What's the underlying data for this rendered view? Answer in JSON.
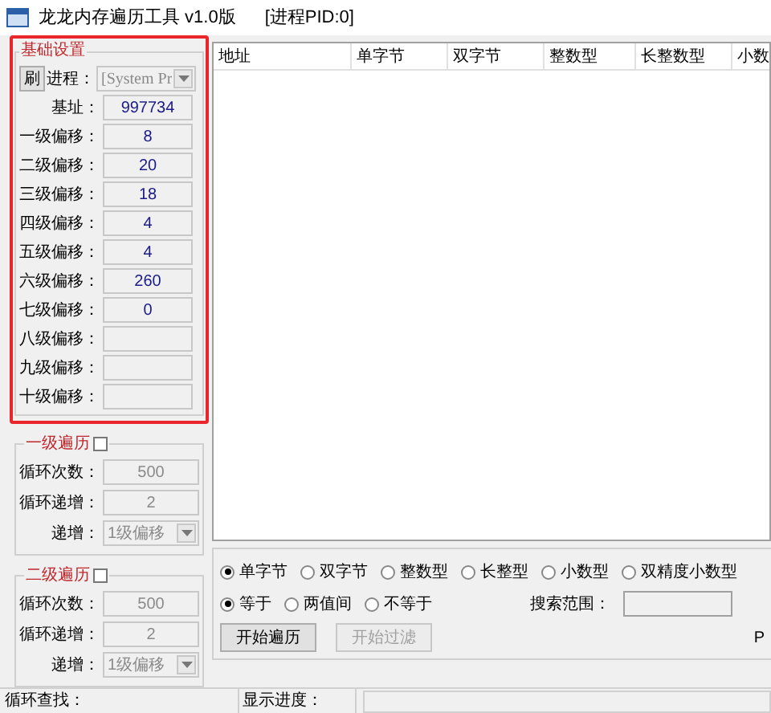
{
  "window": {
    "title": "龙龙内存遍历工具 v1.0版",
    "pid_label": "[进程PID:0]"
  },
  "basic_settings": {
    "title": "基础设置",
    "refresh_button": "刷",
    "process_label": "进程：",
    "process_value": "[System Pr",
    "fields": [
      {
        "label": "基址：",
        "value": "997734"
      },
      {
        "label": "一级偏移：",
        "value": "8"
      },
      {
        "label": "二级偏移：",
        "value": "20"
      },
      {
        "label": "三级偏移：",
        "value": "18"
      },
      {
        "label": "四级偏移：",
        "value": "4"
      },
      {
        "label": "五级偏移：",
        "value": "4"
      },
      {
        "label": "六级偏移：",
        "value": "260"
      },
      {
        "label": "七级偏移：",
        "value": "0"
      },
      {
        "label": "八级偏移："
      },
      {
        "label": "九级偏移："
      },
      {
        "label": "十级偏移："
      }
    ]
  },
  "loops": [
    {
      "title": "一级遍历",
      "checked": false,
      "fields": [
        {
          "kind": "text",
          "label": "循环次数：",
          "value": "500"
        },
        {
          "kind": "text",
          "label": "循环递增：",
          "value": "2"
        },
        {
          "kind": "combo",
          "label": "递增：",
          "value": "1级偏移"
        }
      ]
    },
    {
      "title": "二级遍历",
      "checked": false,
      "fields": [
        {
          "kind": "text",
          "label": "循环次数：",
          "value": "500"
        },
        {
          "kind": "text",
          "label": "循环递增：",
          "value": "2"
        },
        {
          "kind": "combo",
          "label": "递增：",
          "value": "1级偏移"
        }
      ]
    }
  ],
  "table": {
    "columns": [
      "地址",
      "单字节",
      "双字节",
      "整数型",
      "长整数型",
      "小数"
    ]
  },
  "search": {
    "types": [
      {
        "label": "单字节",
        "selected": true
      },
      {
        "label": "双字节",
        "selected": false
      },
      {
        "label": "整数型",
        "selected": false
      },
      {
        "label": "长整型",
        "selected": false
      },
      {
        "label": "小数型",
        "selected": false
      },
      {
        "label": "双精度小数型",
        "selected": false
      }
    ],
    "compare": [
      {
        "label": "等于",
        "selected": true
      },
      {
        "label": "两值间",
        "selected": false
      },
      {
        "label": "不等于",
        "selected": false
      }
    ],
    "range_label": "搜索范围：",
    "buttons": [
      {
        "label": "开始遍历",
        "disabled": false
      },
      {
        "label": "开始过滤",
        "disabled": true
      }
    ],
    "edge_text": "P"
  },
  "status_bar": {
    "loop_label": "循环查找：",
    "progress_label": "显示进度："
  }
}
